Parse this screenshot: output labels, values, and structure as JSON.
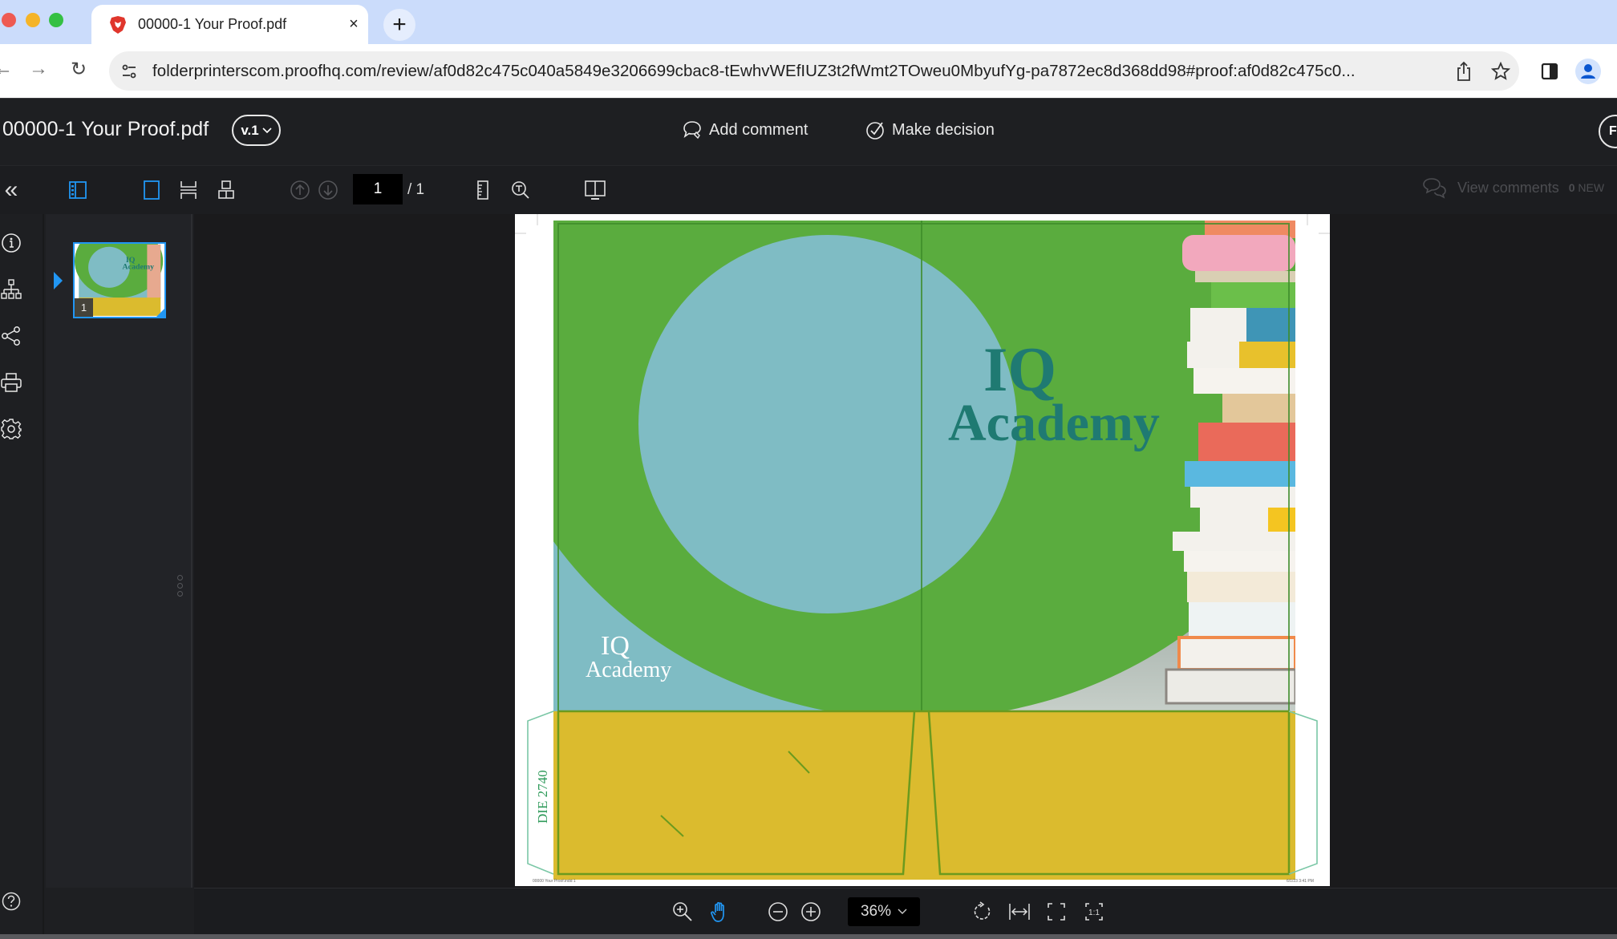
{
  "browser": {
    "tab": {
      "title": "00000-1 Your Proof.pdf",
      "close_label": "×",
      "favicon": "brave-lion-icon"
    },
    "new_tab_label": "+",
    "nav": {
      "back": "←",
      "forward": "→",
      "reload": "↻"
    },
    "url": "folderprinterscom.proofhq.com/review/af0d82c475c040a5849e3206699cbac8-tEwhvWEfIUZ3t2fWmt2TOweu0MbyufYg-pa7872ec8d368dd98#proof:af0d82c475c0...",
    "icons": [
      "site-settings-icon",
      "share-icon",
      "bookmark-star-icon",
      "sidebar-toggle-icon",
      "profile-icon"
    ]
  },
  "header": {
    "doc_title": "00000-1 Your Proof.pdf",
    "version": "v.1",
    "add_comment": "Add comment",
    "make_decision": "Make decision",
    "avatar_initial": "F"
  },
  "viewer_toolbar": {
    "collapse_label": "«",
    "current_page": "1",
    "total_pages": "/ 1",
    "view_comments": "View comments",
    "new_count": "0",
    "new_label": "NEW"
  },
  "thumbnails": [
    {
      "page_number": "1",
      "selected": true
    }
  ],
  "document": {
    "title_line1": "IQ",
    "title_line2": "Academy",
    "small_title_line1": "IQ",
    "small_title_line2": "Academy",
    "die_label": "DIE 2740",
    "footer_left": "00000 Your Proof.indd 1",
    "footer_right": "6/1/23 3:41 PM",
    "colors": {
      "green": "#5aac3e",
      "light_blue": "#7fbcc4",
      "yellow": "#dbbb2e",
      "teal_text": "#1f7a72",
      "die_line": "#7ac7a6"
    }
  },
  "bottom_bar": {
    "zoom_level": "36%",
    "active_tool": "pan"
  },
  "colors": {
    "accent": "#2196f3",
    "app_bg": "#1e1f22",
    "tabstrip": "#cbdcfb"
  }
}
